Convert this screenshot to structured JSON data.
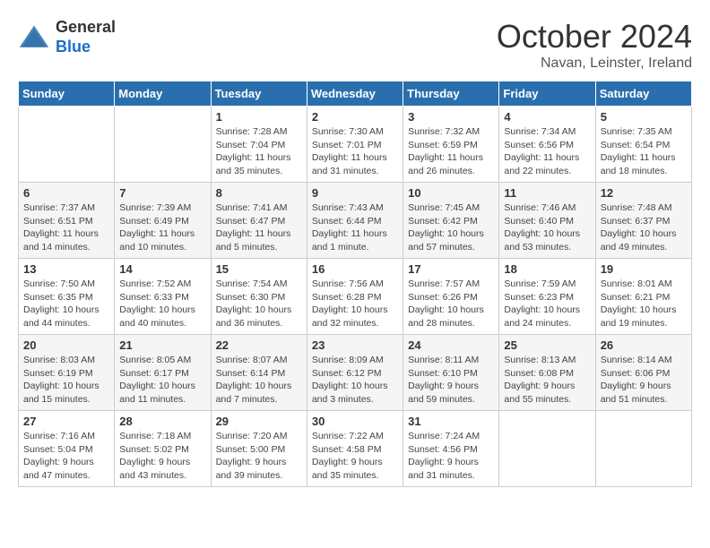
{
  "header": {
    "logo_general": "General",
    "logo_blue": "Blue",
    "month_title": "October 2024",
    "subtitle": "Navan, Leinster, Ireland"
  },
  "days_of_week": [
    "Sunday",
    "Monday",
    "Tuesday",
    "Wednesday",
    "Thursday",
    "Friday",
    "Saturday"
  ],
  "weeks": [
    [
      {
        "day": "",
        "info": ""
      },
      {
        "day": "",
        "info": ""
      },
      {
        "day": "1",
        "info": "Sunrise: 7:28 AM\nSunset: 7:04 PM\nDaylight: 11 hours and 35 minutes."
      },
      {
        "day": "2",
        "info": "Sunrise: 7:30 AM\nSunset: 7:01 PM\nDaylight: 11 hours and 31 minutes."
      },
      {
        "day": "3",
        "info": "Sunrise: 7:32 AM\nSunset: 6:59 PM\nDaylight: 11 hours and 26 minutes."
      },
      {
        "day": "4",
        "info": "Sunrise: 7:34 AM\nSunset: 6:56 PM\nDaylight: 11 hours and 22 minutes."
      },
      {
        "day": "5",
        "info": "Sunrise: 7:35 AM\nSunset: 6:54 PM\nDaylight: 11 hours and 18 minutes."
      }
    ],
    [
      {
        "day": "6",
        "info": "Sunrise: 7:37 AM\nSunset: 6:51 PM\nDaylight: 11 hours and 14 minutes."
      },
      {
        "day": "7",
        "info": "Sunrise: 7:39 AM\nSunset: 6:49 PM\nDaylight: 11 hours and 10 minutes."
      },
      {
        "day": "8",
        "info": "Sunrise: 7:41 AM\nSunset: 6:47 PM\nDaylight: 11 hours and 5 minutes."
      },
      {
        "day": "9",
        "info": "Sunrise: 7:43 AM\nSunset: 6:44 PM\nDaylight: 11 hours and 1 minute."
      },
      {
        "day": "10",
        "info": "Sunrise: 7:45 AM\nSunset: 6:42 PM\nDaylight: 10 hours and 57 minutes."
      },
      {
        "day": "11",
        "info": "Sunrise: 7:46 AM\nSunset: 6:40 PM\nDaylight: 10 hours and 53 minutes."
      },
      {
        "day": "12",
        "info": "Sunrise: 7:48 AM\nSunset: 6:37 PM\nDaylight: 10 hours and 49 minutes."
      }
    ],
    [
      {
        "day": "13",
        "info": "Sunrise: 7:50 AM\nSunset: 6:35 PM\nDaylight: 10 hours and 44 minutes."
      },
      {
        "day": "14",
        "info": "Sunrise: 7:52 AM\nSunset: 6:33 PM\nDaylight: 10 hours and 40 minutes."
      },
      {
        "day": "15",
        "info": "Sunrise: 7:54 AM\nSunset: 6:30 PM\nDaylight: 10 hours and 36 minutes."
      },
      {
        "day": "16",
        "info": "Sunrise: 7:56 AM\nSunset: 6:28 PM\nDaylight: 10 hours and 32 minutes."
      },
      {
        "day": "17",
        "info": "Sunrise: 7:57 AM\nSunset: 6:26 PM\nDaylight: 10 hours and 28 minutes."
      },
      {
        "day": "18",
        "info": "Sunrise: 7:59 AM\nSunset: 6:23 PM\nDaylight: 10 hours and 24 minutes."
      },
      {
        "day": "19",
        "info": "Sunrise: 8:01 AM\nSunset: 6:21 PM\nDaylight: 10 hours and 19 minutes."
      }
    ],
    [
      {
        "day": "20",
        "info": "Sunrise: 8:03 AM\nSunset: 6:19 PM\nDaylight: 10 hours and 15 minutes."
      },
      {
        "day": "21",
        "info": "Sunrise: 8:05 AM\nSunset: 6:17 PM\nDaylight: 10 hours and 11 minutes."
      },
      {
        "day": "22",
        "info": "Sunrise: 8:07 AM\nSunset: 6:14 PM\nDaylight: 10 hours and 7 minutes."
      },
      {
        "day": "23",
        "info": "Sunrise: 8:09 AM\nSunset: 6:12 PM\nDaylight: 10 hours and 3 minutes."
      },
      {
        "day": "24",
        "info": "Sunrise: 8:11 AM\nSunset: 6:10 PM\nDaylight: 9 hours and 59 minutes."
      },
      {
        "day": "25",
        "info": "Sunrise: 8:13 AM\nSunset: 6:08 PM\nDaylight: 9 hours and 55 minutes."
      },
      {
        "day": "26",
        "info": "Sunrise: 8:14 AM\nSunset: 6:06 PM\nDaylight: 9 hours and 51 minutes."
      }
    ],
    [
      {
        "day": "27",
        "info": "Sunrise: 7:16 AM\nSunset: 5:04 PM\nDaylight: 9 hours and 47 minutes."
      },
      {
        "day": "28",
        "info": "Sunrise: 7:18 AM\nSunset: 5:02 PM\nDaylight: 9 hours and 43 minutes."
      },
      {
        "day": "29",
        "info": "Sunrise: 7:20 AM\nSunset: 5:00 PM\nDaylight: 9 hours and 39 minutes."
      },
      {
        "day": "30",
        "info": "Sunrise: 7:22 AM\nSunset: 4:58 PM\nDaylight: 9 hours and 35 minutes."
      },
      {
        "day": "31",
        "info": "Sunrise: 7:24 AM\nSunset: 4:56 PM\nDaylight: 9 hours and 31 minutes."
      },
      {
        "day": "",
        "info": ""
      },
      {
        "day": "",
        "info": ""
      }
    ]
  ]
}
